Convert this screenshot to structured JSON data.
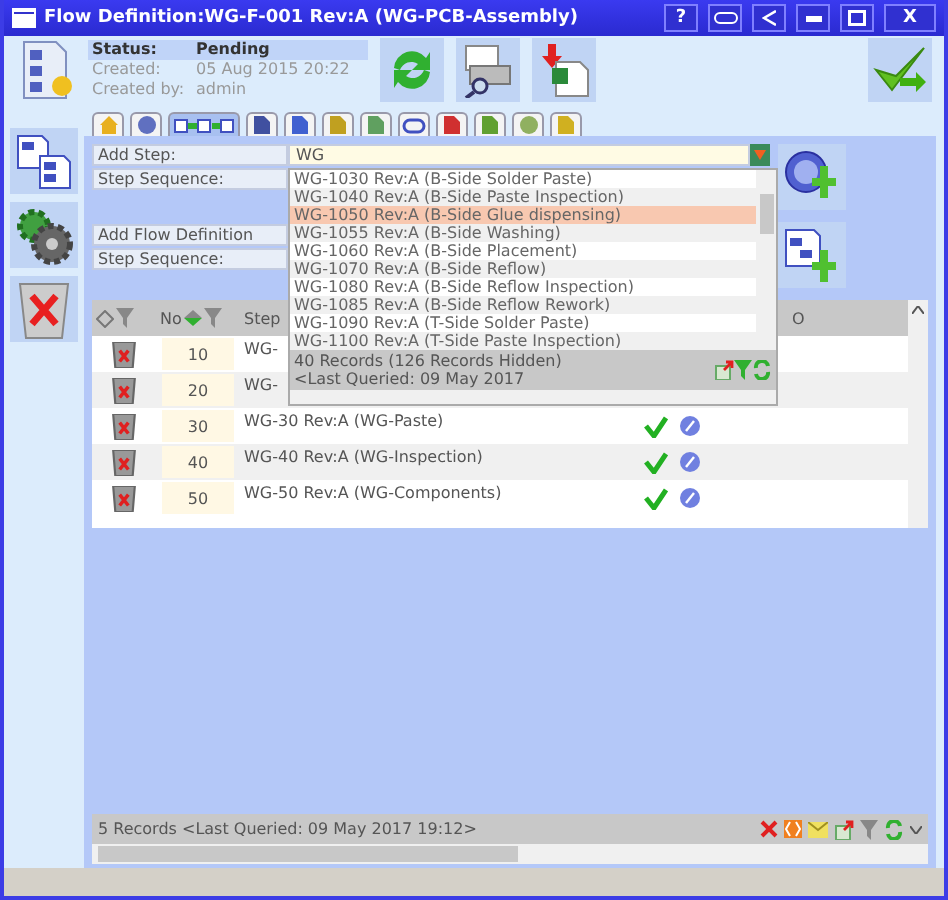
{
  "window": {
    "title": "Flow Definition:WG-F-001 Rev:A (WG-PCB-Assembly)",
    "help": "?",
    "close": "X"
  },
  "header": {
    "status_label": "Status:",
    "status": "Pending",
    "created_label": "Created:",
    "created": "05 Aug 2015 20:22",
    "created_by_label": "Created by:",
    "created_by": "admin"
  },
  "tabs": [
    {
      "selected": false
    },
    {
      "selected": false
    },
    {
      "selected": true
    },
    {
      "selected": false
    },
    {
      "selected": false
    },
    {
      "selected": false
    },
    {
      "selected": false
    },
    {
      "selected": false
    },
    {
      "selected": false
    },
    {
      "selected": false
    },
    {
      "selected": false
    },
    {
      "selected": false
    }
  ],
  "form": {
    "add_step": {
      "label": "Add Step:",
      "value": "WG"
    },
    "step_sequence_1": {
      "label": "Step Sequence:"
    },
    "add_flow": {
      "label": "Add Flow Definition"
    },
    "step_sequence_2": {
      "label": "Step Sequence:"
    }
  },
  "dropdown": {
    "items": [
      {
        "text": "WG-1030 Rev:A (B-Side Solder Paste)",
        "selected": false
      },
      {
        "text": "WG-1040 Rev:A (B-Side Paste Inspection)",
        "selected": false
      },
      {
        "text": "WG-1050 Rev:A (B-Side Glue dispensing)",
        "selected": true
      },
      {
        "text": "WG-1055 Rev:A (B-Side Washing)",
        "selected": false
      },
      {
        "text": "WG-1060 Rev:A (B-Side Placement)",
        "selected": false
      },
      {
        "text": "WG-1070 Rev:A (B-Side Reflow)",
        "selected": false
      },
      {
        "text": "WG-1080 Rev:A (B-Side Reflow Inspection)",
        "selected": false
      },
      {
        "text": "WG-1085 Rev:A (B-Side Reflow Rework)",
        "selected": false
      },
      {
        "text": "WG-1090 Rev:A (T-Side Solder Paste)",
        "selected": false
      },
      {
        "text": "WG-1100 Rev:A (T-Side Paste Inspection)",
        "selected": false
      }
    ],
    "records": "40 Records (126 Records Hidden)",
    "queried": "<Last Queried: 09 May 2017"
  },
  "table": {
    "columns": [
      "No",
      "Step",
      "O"
    ],
    "rows": [
      {
        "no": "10",
        "step": "WG-"
      },
      {
        "no": "20",
        "step": "WG-"
      },
      {
        "no": "30",
        "step": "WG-30 Rev:A (WG-Paste)",
        "approved": true
      },
      {
        "no": "40",
        "step": "WG-40 Rev:A (WG-Inspection)",
        "approved": true
      },
      {
        "no": "50",
        "step": "WG-50 Rev:A (WG-Components)",
        "approved": true
      }
    ]
  },
  "status": "5 Records <Last Queried: 09 May 2017 19:12>"
}
